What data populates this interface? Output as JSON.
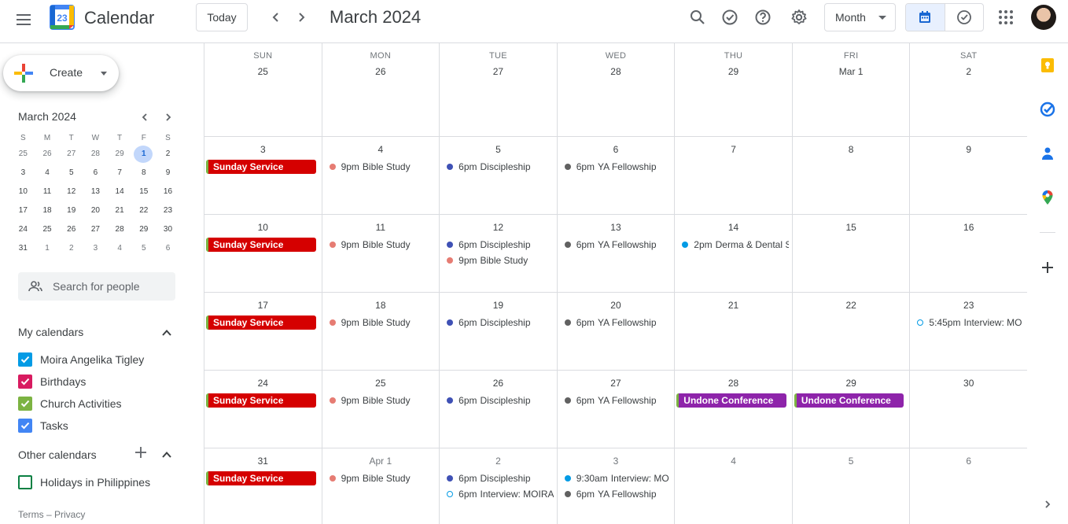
{
  "header": {
    "app_title": "Calendar",
    "logo_day": "23",
    "today_label": "Today",
    "month_title": "March 2024",
    "view_label": "Month"
  },
  "sidebar": {
    "create_label": "Create",
    "mini_title": "March 2024",
    "mini_dow": [
      "S",
      "M",
      "T",
      "W",
      "T",
      "F",
      "S"
    ],
    "mini_weeks": [
      [
        {
          "d": "25",
          "m": true
        },
        {
          "d": "26",
          "m": true
        },
        {
          "d": "27",
          "m": true
        },
        {
          "d": "28",
          "m": true
        },
        {
          "d": "29",
          "m": true
        },
        {
          "d": "1",
          "today": true
        },
        {
          "d": "2"
        }
      ],
      [
        {
          "d": "3"
        },
        {
          "d": "4"
        },
        {
          "d": "5"
        },
        {
          "d": "6"
        },
        {
          "d": "7"
        },
        {
          "d": "8"
        },
        {
          "d": "9"
        }
      ],
      [
        {
          "d": "10"
        },
        {
          "d": "11"
        },
        {
          "d": "12"
        },
        {
          "d": "13"
        },
        {
          "d": "14"
        },
        {
          "d": "15"
        },
        {
          "d": "16"
        }
      ],
      [
        {
          "d": "17"
        },
        {
          "d": "18"
        },
        {
          "d": "19"
        },
        {
          "d": "20"
        },
        {
          "d": "21"
        },
        {
          "d": "22"
        },
        {
          "d": "23"
        }
      ],
      [
        {
          "d": "24"
        },
        {
          "d": "25"
        },
        {
          "d": "26"
        },
        {
          "d": "27"
        },
        {
          "d": "28"
        },
        {
          "d": "29"
        },
        {
          "d": "30"
        }
      ],
      [
        {
          "d": "31"
        },
        {
          "d": "1",
          "m": true
        },
        {
          "d": "2",
          "m": true
        },
        {
          "d": "3",
          "m": true
        },
        {
          "d": "4",
          "m": true
        },
        {
          "d": "5",
          "m": true
        },
        {
          "d": "6",
          "m": true
        }
      ]
    ],
    "search_placeholder": "Search for people",
    "my_calendars_title": "My calendars",
    "my_calendars": [
      {
        "name": "Moira Angelika Tigley",
        "color": "#039be5",
        "checked": true
      },
      {
        "name": "Birthdays",
        "color": "#d81b60",
        "checked": true
      },
      {
        "name": "Church Activities",
        "color": "#7cb342",
        "checked": true
      },
      {
        "name": "Tasks",
        "color": "#4285f4",
        "checked": true
      }
    ],
    "other_calendars_title": "Other calendars",
    "other_calendars": [
      {
        "name": "Holidays in Philippines",
        "color": "#0b8043",
        "checked": false
      }
    ],
    "footer_terms": "Terms",
    "footer_sep": " – ",
    "footer_privacy": "Privacy"
  },
  "colors": {
    "service_red": "#d50000",
    "conference_purple": "#8e24aa",
    "bible_study": "#e67c73",
    "discipleship": "#3f51b5",
    "ya_fellowship": "#616161",
    "derma": "#039be5",
    "interview": "#039be5",
    "accent_blue": "#1a73e8"
  },
  "calendar": {
    "dow": [
      "SUN",
      "MON",
      "TUE",
      "WED",
      "THU",
      "FRI",
      "SAT"
    ],
    "weeks": [
      [
        {
          "date": "25",
          "events": []
        },
        {
          "date": "26",
          "events": []
        },
        {
          "date": "27",
          "events": []
        },
        {
          "date": "28",
          "events": []
        },
        {
          "date": "29",
          "events": []
        },
        {
          "date": "Mar 1",
          "events": []
        },
        {
          "date": "2",
          "events": []
        }
      ],
      [
        {
          "date": "3",
          "events": [
            {
              "kind": "bar",
              "title": "Sunday Service",
              "color": "#d50000"
            }
          ]
        },
        {
          "date": "4",
          "events": [
            {
              "kind": "dot",
              "time": "9pm",
              "title": "Bible Study",
              "color": "#e67c73"
            }
          ]
        },
        {
          "date": "5",
          "events": [
            {
              "kind": "dot",
              "time": "6pm",
              "title": "Discipleship",
              "color": "#3f51b5"
            }
          ]
        },
        {
          "date": "6",
          "events": [
            {
              "kind": "dot",
              "time": "6pm",
              "title": "YA Fellowship",
              "color": "#616161"
            }
          ]
        },
        {
          "date": "7",
          "events": []
        },
        {
          "date": "8",
          "events": []
        },
        {
          "date": "9",
          "events": []
        }
      ],
      [
        {
          "date": "10",
          "events": [
            {
              "kind": "bar",
              "title": "Sunday Service",
              "color": "#d50000"
            }
          ]
        },
        {
          "date": "11",
          "events": [
            {
              "kind": "dot",
              "time": "9pm",
              "title": "Bible Study",
              "color": "#e67c73"
            }
          ]
        },
        {
          "date": "12",
          "events": [
            {
              "kind": "dot",
              "time": "6pm",
              "title": "Discipleship",
              "color": "#3f51b5"
            },
            {
              "kind": "dot",
              "time": "9pm",
              "title": "Bible Study",
              "color": "#e67c73"
            }
          ]
        },
        {
          "date": "13",
          "events": [
            {
              "kind": "dot",
              "time": "6pm",
              "title": "YA Fellowship",
              "color": "#616161"
            }
          ]
        },
        {
          "date": "14",
          "events": [
            {
              "kind": "dot",
              "time": "2pm",
              "title": "Derma & Dental S",
              "color": "#039be5"
            }
          ]
        },
        {
          "date": "15",
          "events": []
        },
        {
          "date": "16",
          "events": []
        }
      ],
      [
        {
          "date": "17",
          "events": [
            {
              "kind": "bar",
              "title": "Sunday Service",
              "color": "#d50000"
            }
          ]
        },
        {
          "date": "18",
          "events": [
            {
              "kind": "dot",
              "time": "9pm",
              "title": "Bible Study",
              "color": "#e67c73"
            }
          ]
        },
        {
          "date": "19",
          "events": [
            {
              "kind": "dot",
              "time": "6pm",
              "title": "Discipleship",
              "color": "#3f51b5"
            }
          ]
        },
        {
          "date": "20",
          "events": [
            {
              "kind": "dot",
              "time": "6pm",
              "title": "YA Fellowship",
              "color": "#616161"
            }
          ]
        },
        {
          "date": "21",
          "events": []
        },
        {
          "date": "22",
          "events": []
        },
        {
          "date": "23",
          "events": [
            {
              "kind": "dot",
              "ring": true,
              "time": "5:45pm",
              "title": "Interview: MO",
              "color": "#039be5"
            }
          ]
        }
      ],
      [
        {
          "date": "24",
          "events": [
            {
              "kind": "bar",
              "title": "Sunday Service",
              "color": "#d50000"
            }
          ]
        },
        {
          "date": "25",
          "events": [
            {
              "kind": "dot",
              "time": "9pm",
              "title": "Bible Study",
              "color": "#e67c73"
            }
          ]
        },
        {
          "date": "26",
          "events": [
            {
              "kind": "dot",
              "time": "6pm",
              "title": "Discipleship",
              "color": "#3f51b5"
            }
          ]
        },
        {
          "date": "27",
          "events": [
            {
              "kind": "dot",
              "time": "6pm",
              "title": "YA Fellowship",
              "color": "#616161"
            }
          ]
        },
        {
          "date": "28",
          "events": [
            {
              "kind": "bar",
              "title": "Undone Conference",
              "color": "#8e24aa"
            }
          ]
        },
        {
          "date": "29",
          "events": [
            {
              "kind": "bar",
              "title": "Undone Conference",
              "color": "#8e24aa"
            }
          ]
        },
        {
          "date": "30",
          "events": []
        }
      ],
      [
        {
          "date": "31",
          "events": [
            {
              "kind": "bar",
              "title": "Sunday Service",
              "color": "#d50000"
            }
          ]
        },
        {
          "date": "Apr 1",
          "muted": true,
          "events": [
            {
              "kind": "dot",
              "time": "9pm",
              "title": "Bible Study",
              "color": "#e67c73"
            }
          ]
        },
        {
          "date": "2",
          "muted": true,
          "events": [
            {
              "kind": "dot",
              "time": "6pm",
              "title": "Discipleship",
              "color": "#3f51b5"
            },
            {
              "kind": "dot",
              "ring": true,
              "time": "6pm",
              "title": "Interview: MOIRA",
              "color": "#039be5"
            }
          ]
        },
        {
          "date": "3",
          "muted": true,
          "events": [
            {
              "kind": "dot",
              "time": "9:30am",
              "title": "Interview: MO",
              "color": "#039be5"
            },
            {
              "kind": "dot",
              "time": "6pm",
              "title": "YA Fellowship",
              "color": "#616161"
            }
          ]
        },
        {
          "date": "4",
          "muted": true,
          "events": []
        },
        {
          "date": "5",
          "muted": true,
          "events": []
        },
        {
          "date": "6",
          "muted": true,
          "events": []
        }
      ]
    ]
  }
}
